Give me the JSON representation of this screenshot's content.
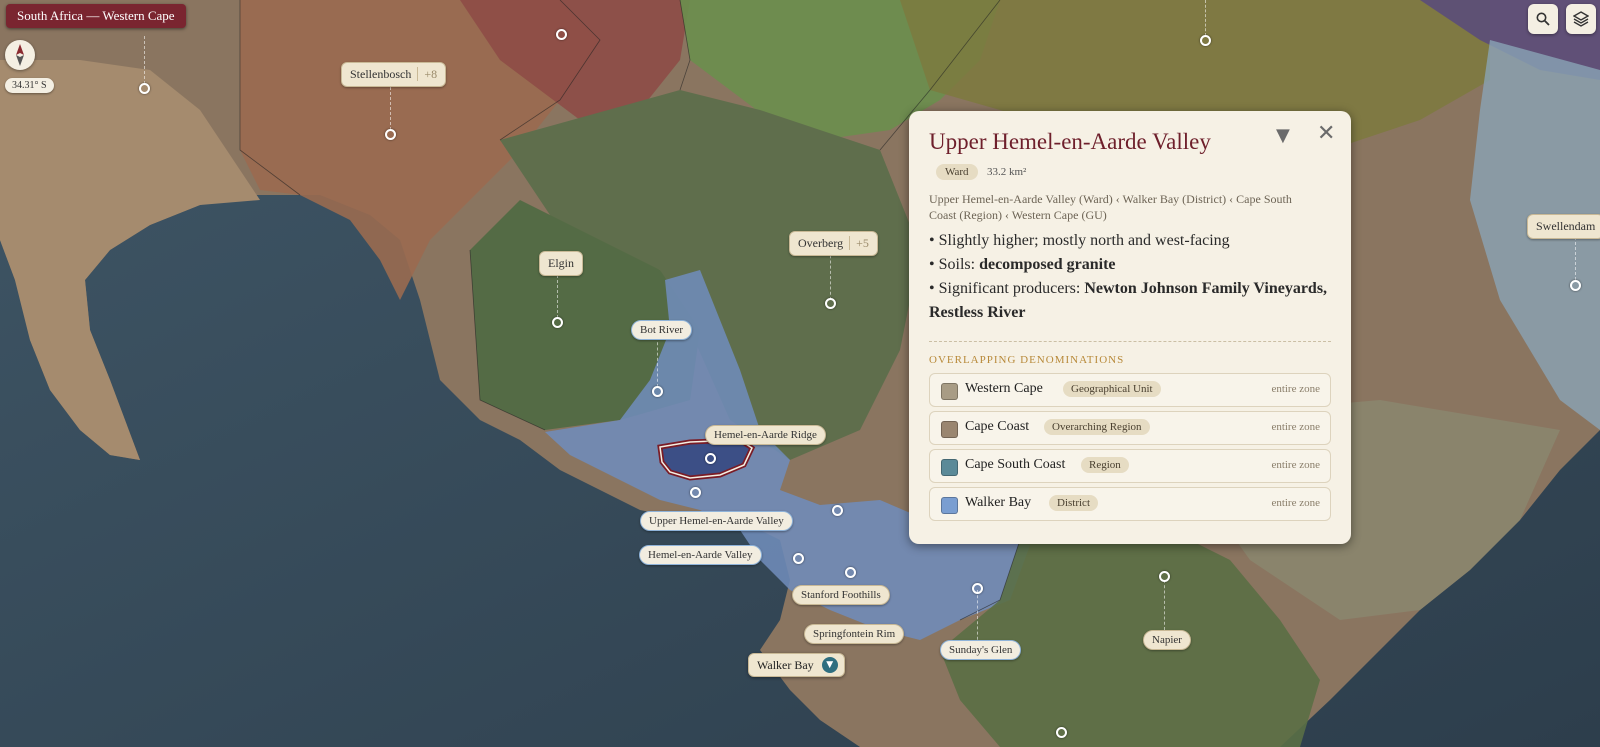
{
  "header": {
    "title": "South Africa — Western Cape"
  },
  "coordinates": {
    "latitude": "34.31° S"
  },
  "toolbar": {
    "search_icon": "search-icon",
    "layers_icon": "layers-icon"
  },
  "map_labels": {
    "stellenbosch": {
      "name": "Stellenbosch",
      "more": "+8"
    },
    "overberg": {
      "name": "Overberg",
      "more": "+5"
    },
    "elgin": "Elgin",
    "bot_river": "Bot River",
    "hemel_ridge": "Hemel-en-Aarde Ridge",
    "upper_hemel": "Upper Hemel-en-Aarde Valley",
    "hemel_valley": "Hemel-en-Aarde Valley",
    "stanford": "Stanford Foothills",
    "springfontein": "Springfontein Rim",
    "sundays_glen": "Sunday's Glen",
    "napier": "Napier",
    "swellendam": "Swellendam",
    "walker_bay": "Walker Bay"
  },
  "panel": {
    "title": "Upper Hemel-en-Aarde Valley",
    "type": "Ward",
    "area": "33.2 km²",
    "hierarchy": "Upper Hemel-en-Aarde Valley (Ward) ‹ Walker Bay (District) ‹ Cape South Coast (Region) ‹ Western Cape (GU)",
    "bullet1": "• Slightly higher; mostly north and west-facing",
    "bullet2_prefix": "• Soils: ",
    "bullet2_bold": "decomposed granite",
    "bullet3_prefix": "• Significant producers: ",
    "bullet3_bold": "Newton Johnson Family Vineyards, Restless River",
    "overlap_heading": "OVERLAPPING DENOMINATIONS",
    "overlaps": [
      {
        "name": "Western Cape",
        "tag": "Geographical Unit",
        "coverage": "entire zone",
        "color": "#a89c85"
      },
      {
        "name": "Cape Coast",
        "tag": "Overarching Region",
        "coverage": "entire zone",
        "color": "#9a8670"
      },
      {
        "name": "Cape South Coast",
        "tag": "Region",
        "coverage": "entire zone",
        "color": "#5b8a98"
      },
      {
        "name": "Walker Bay",
        "tag": "District",
        "coverage": "entire zone",
        "color": "#7a9ed1"
      }
    ]
  }
}
